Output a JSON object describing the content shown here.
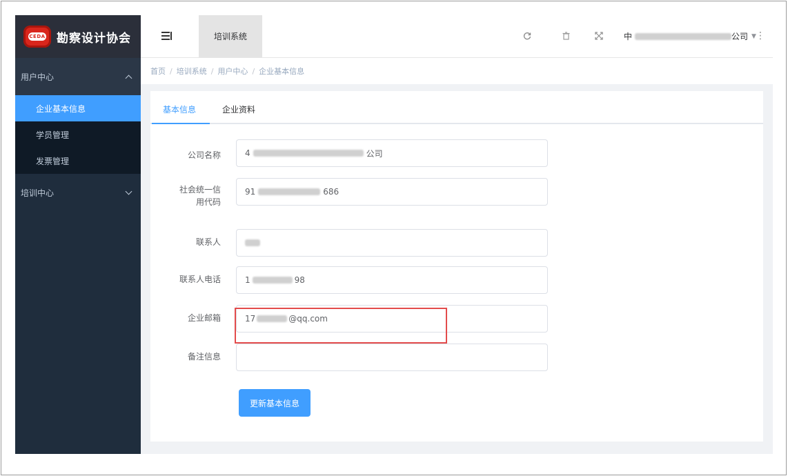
{
  "brand": {
    "logo_text": "CEDA",
    "name": "勘察设计协会"
  },
  "sidebar": {
    "groups": [
      {
        "label": "用户中心",
        "expanded": true
      },
      {
        "label": "培训中心",
        "expanded": false
      }
    ],
    "items": [
      {
        "label": "企业基本信息",
        "active": true
      },
      {
        "label": "学员管理",
        "active": false
      },
      {
        "label": "发票管理",
        "active": false
      }
    ]
  },
  "header": {
    "menu_icon": "hamburger-icon",
    "active_tab": "培训系统",
    "icons": [
      "refresh-icon",
      "trash-icon",
      "fullscreen-icon",
      "more-icon"
    ],
    "user": {
      "prefix": "中",
      "suffix": "公司"
    }
  },
  "breadcrumb": [
    "首页",
    "培训系统",
    "用户中心",
    "企业基本信息"
  ],
  "tabs": [
    {
      "label": "基本信息",
      "active": true
    },
    {
      "label": "企业资料",
      "active": false
    }
  ],
  "form": {
    "company_name": {
      "label": "公司名称",
      "value": "4 公司"
    },
    "credit_code": {
      "label_line1": "社会统一信",
      "label_line2": "用代码",
      "value": "91 686"
    },
    "contact": {
      "label": "联系人",
      "value": ""
    },
    "contact_phone": {
      "label": "联系人电话",
      "value": "1 98"
    },
    "email": {
      "label": "企业邮箱",
      "value": "17 @qq.com"
    },
    "remarks": {
      "label": "备注信息",
      "value": ""
    },
    "submit_label": "更新基本信息"
  },
  "colors": {
    "sidebar_bg": "#1f2d3d",
    "accent": "#409eff",
    "highlight": "#e34b4b"
  }
}
